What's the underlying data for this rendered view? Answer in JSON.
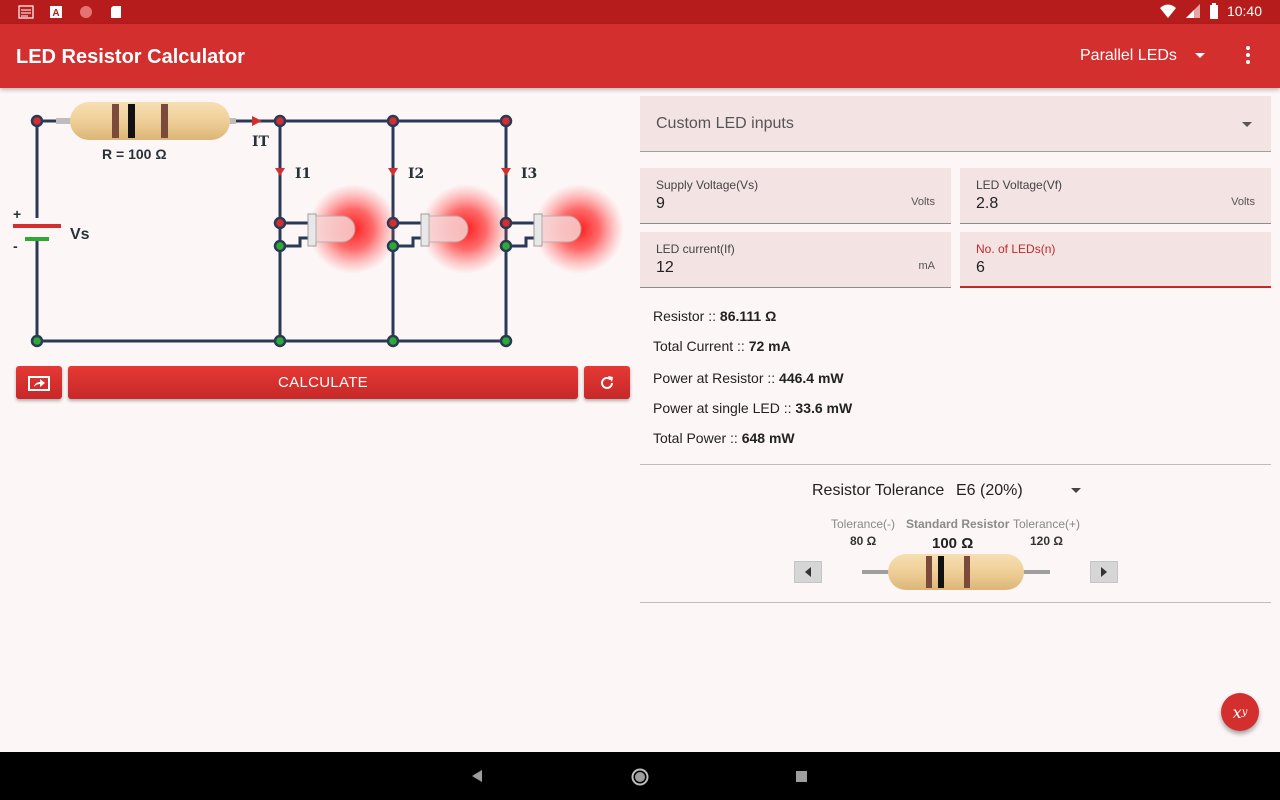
{
  "status_bar": {
    "time": "10:40",
    "icons": [
      "news-icon",
      "font-icon",
      "record-icon",
      "sd-card-icon",
      "wifi-icon",
      "signal-icon",
      "battery-icon"
    ]
  },
  "app_bar": {
    "title": "LED Resistor Calculator",
    "mode": "Parallel LEDs",
    "menu_icon": "more-vert-icon"
  },
  "circuit": {
    "resistor_label": "R = 100 Ω",
    "total_current_label": "IT",
    "branch_currents": [
      "I1",
      "I2",
      "I3"
    ],
    "plus": "+",
    "minus": "-",
    "vs_label": "Vs"
  },
  "actions": {
    "share_icon": "share-icon",
    "calculate_label": "CALCULATE",
    "reset_icon": "refresh-icon"
  },
  "inputs": {
    "led_type": "Custom LED inputs",
    "supply_voltage": {
      "label": "Supply Voltage(Vs)",
      "value": "9",
      "unit": "Volts"
    },
    "led_voltage": {
      "label": "LED Voltage(Vf)",
      "value": "2.8",
      "unit": "Volts"
    },
    "led_current": {
      "label": "LED current(If)",
      "value": "12",
      "unit": "mA"
    },
    "num_leds": {
      "label": "No. of LEDs(n)",
      "value": "6"
    }
  },
  "results": {
    "resistor": {
      "label": "Resistor :: ",
      "value": "86.111 Ω"
    },
    "total_current": {
      "label": "Total Current :: ",
      "value": "72 mA"
    },
    "power_resistor": {
      "label": "Power at Resistor :: ",
      "value": "446.4 mW"
    },
    "power_led": {
      "label": "Power at single LED :: ",
      "value": "33.6 mW"
    },
    "total_power": {
      "label": "Total Power :: ",
      "value": "648 mW"
    }
  },
  "tolerance": {
    "label": "Resistor Tolerance",
    "selected": "E6 (20%)",
    "minus_label": "Tolerance(-)",
    "minus_value": "80 Ω",
    "standard_label": "Standard Resistor",
    "standard_value": "100 Ω",
    "plus_label": "Tolerance(+)",
    "plus_value": "120 Ω"
  },
  "fab_label": "x",
  "fab_sup": "y",
  "colors": {
    "primary": "#d32f2f",
    "primary_dark": "#b71c1c",
    "field_bg": "#f3e3e3",
    "page_bg": "#fdf6f6",
    "wire": "#2a3a56",
    "led_glow": "#ff2a2a"
  }
}
